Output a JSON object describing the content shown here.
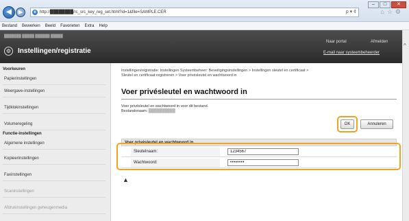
{
  "browser": {
    "address": "http://████████/rc_src_key_reg_set.html?id=1&file=SAMPLE.CER",
    "address_controls": "ρ ▾ ¢",
    "menu": [
      "Bestand",
      "Bewerken",
      "Beeld",
      "Favorieten",
      "Extra",
      "Help"
    ]
  },
  "header": {
    "device_info": "███████ █████ ██████ █████",
    "title": "Instellingen/registratie",
    "portal_link": "Naar portal",
    "logout_link": "Afmelden",
    "email_link": "E-mail naar systeembeheerder"
  },
  "sidebar": {
    "heading_prefs": "Voorkeuren",
    "prefs_items": [
      "Papierinstellingen",
      "Weergave-instellingen",
      "Tijdklokinstellingen",
      "Volumeregeling"
    ],
    "heading_functions": "Functie-instellingen",
    "function_items": [
      "Algemene instellingen",
      "Kopieerinstellingen",
      "Faxinstellingen",
      "Scaninstellingen",
      "Afdrukinstellingen geheugenmedia"
    ]
  },
  "main": {
    "breadcrumb_line1": "Instellingen/registratie: Instellingen Systeembeheer: Beveiligingsinstellingen > Instellingen sleutel en certificaat >",
    "breadcrumb_line2": "Sleutel en certificaat registreren > Voer privésleutel en wachtwoord in",
    "title": "Voer privésleutel en wachtwoord in",
    "desc_line1": "Voer privésleutel en wachtwoord in voor dit bestand.",
    "desc_label": "Bestandsnaam:",
    "desc_filename": "██████████",
    "ok_label": "OK",
    "cancel_label": "Annuleren",
    "form_header": "Voer privésleutel en wachtwoord in",
    "key_label": "Sleutelnaam:",
    "key_value": "1234567",
    "password_label": "Wachtwoord:",
    "password_value": "••••••••",
    "to_top": "▲"
  },
  "colors": {
    "highlight": "#f4a11f",
    "header_bg": "#3a3a3a"
  },
  "icons": [
    "back-icon",
    "forward-icon",
    "ie-logo-icon",
    "home-icon",
    "star-icon",
    "gear-icon",
    "settings-gear-icon",
    "to-top-icon"
  ]
}
